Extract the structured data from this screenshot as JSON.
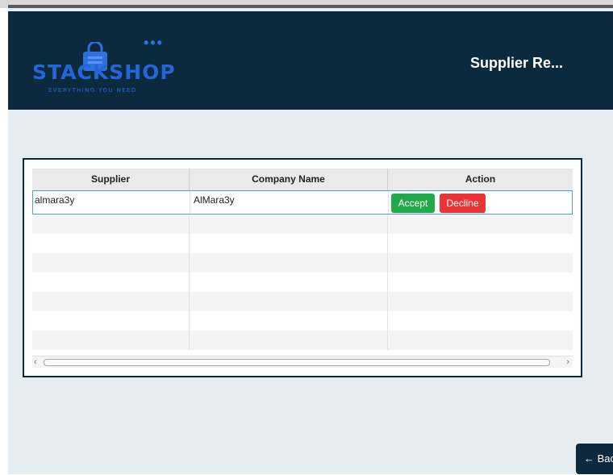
{
  "header": {
    "logo_text": "STACKSHOP",
    "logo_tagline": "EVERYTHING YOU NEED",
    "title": "Supplier Re..."
  },
  "table": {
    "columns": [
      "Supplier",
      "Company Name",
      "Action"
    ],
    "rows": [
      {
        "supplier": "almara3y",
        "company_name": "AlMara3y",
        "accept_label": "Accept",
        "decline_label": "Decline"
      }
    ]
  },
  "back_button": {
    "label": "← Bac"
  },
  "colors": {
    "header_bg": "#0b2a3d",
    "page_bg": "#e6edf1",
    "accept": "#22a94a",
    "decline": "#ec3434",
    "logo_blue": "#2466d9"
  }
}
